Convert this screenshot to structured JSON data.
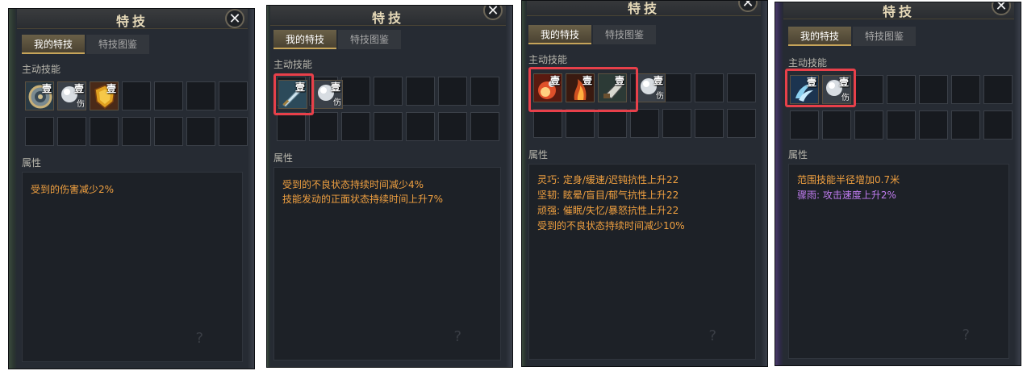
{
  "panels": [
    {
      "title": "特技",
      "close": "✕",
      "tabs": [
        "我的特技",
        "特技图鉴"
      ],
      "section_skills": "主动技能",
      "section_attr": "属性",
      "skills": [
        {
          "icon": "gear-shield-icon",
          "badge": "壹",
          "sub": ""
        },
        {
          "icon": "silver-orb-icon",
          "badge": "壹",
          "sub": "伤"
        },
        {
          "icon": "gold-shield-icon",
          "badge": "壹",
          "sub": ""
        }
      ],
      "attributes": [
        {
          "text": "受到的伤害减少2%",
          "color": "#f0a040"
        }
      ]
    },
    {
      "title": "特技",
      "close": "✕",
      "tabs": [
        "我的特技",
        "特技图鉴"
      ],
      "section_skills": "主动技能",
      "section_attr": "属性",
      "skills": [
        {
          "icon": "blade-icon",
          "badge": "壹",
          "sub": ""
        },
        {
          "icon": "silver-orb-icon",
          "badge": "壹",
          "sub": "伤"
        }
      ],
      "attributes": [
        {
          "text": "受到的不良状态持续时间减少4%",
          "color": "#f0a040"
        },
        {
          "text": "技能发动的正面状态持续时间上升7%",
          "color": "#f0a040"
        }
      ]
    },
    {
      "title": "特技",
      "close": "✕",
      "tabs": [
        "我的特技",
        "特技图鉴"
      ],
      "section_skills": "主动技能",
      "section_attr": "属性",
      "skills": [
        {
          "icon": "fire-burst-icon",
          "badge": "壹",
          "sub": ""
        },
        {
          "icon": "flame-warrior-icon",
          "badge": "壹",
          "sub": ""
        },
        {
          "icon": "glove-icon",
          "badge": "壹",
          "sub": ""
        },
        {
          "icon": "silver-orb-icon",
          "badge": "壹",
          "sub": "伤"
        }
      ],
      "attributes": [
        {
          "text": "灵巧: 定身/缓速/迟钝抗性上升22",
          "color": "#f0a040"
        },
        {
          "text": "坚韧: 眩晕/盲目/郁气抗性上升22",
          "color": "#f0a040"
        },
        {
          "text": "顽强: 催眠/失忆/暴怒抗性上升22",
          "color": "#f0a040"
        },
        {
          "text": "受到的不良状态持续时间减少10%",
          "color": "#f0a040"
        }
      ]
    },
    {
      "title": "特技",
      "close": "✕",
      "tabs": [
        "我的特技",
        "特技图鉴"
      ],
      "section_skills": "主动技能",
      "section_attr": "属性",
      "skills": [
        {
          "icon": "wind-swirl-icon",
          "badge": "壹",
          "sub": ""
        },
        {
          "icon": "silver-orb-icon",
          "badge": "壹",
          "sub": "伤"
        }
      ],
      "attributes": [
        {
          "text": "范围技能半径增加0.7米",
          "color": "#f0a040"
        },
        {
          "text": "骤雨: 攻击速度上升2%",
          "color": "#c07cf0"
        }
      ]
    }
  ]
}
